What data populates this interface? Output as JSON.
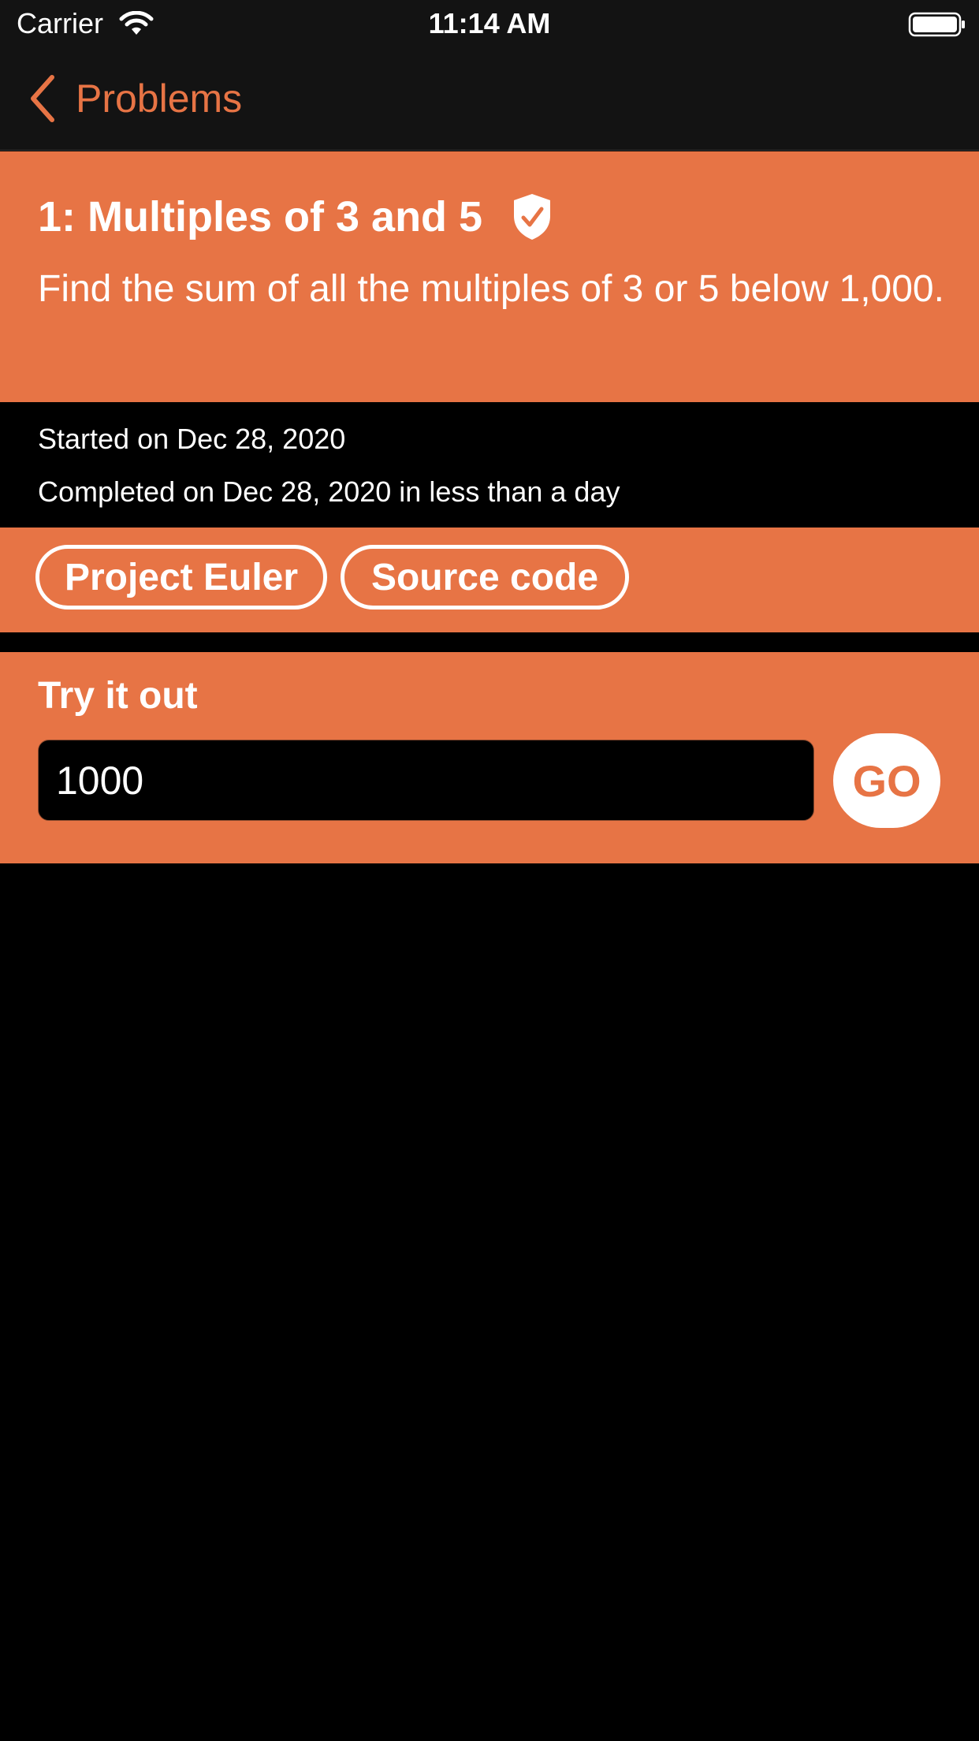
{
  "status_bar": {
    "carrier": "Carrier",
    "time": "11:14 AM"
  },
  "nav": {
    "back_label": "Problems"
  },
  "problem": {
    "title": "1: Multiples of 3 and 5",
    "description": "Find the sum of all the multiples of 3 or 5 below 1,000.",
    "started": "Started on Dec 28, 2020",
    "completed": "Completed on Dec 28, 2020 in less than a day"
  },
  "links": {
    "project_euler": "Project Euler",
    "source_code": "Source code"
  },
  "try_it": {
    "title": "Try it out",
    "input_value": "1000",
    "go_label": "GO"
  },
  "icons": {
    "wifi": "wifi-icon",
    "battery": "battery-icon",
    "back": "chevron-left-icon",
    "solved": "shield-check-icon"
  },
  "colors": {
    "accent": "#e77445",
    "background": "#000000",
    "bar": "#131313"
  }
}
